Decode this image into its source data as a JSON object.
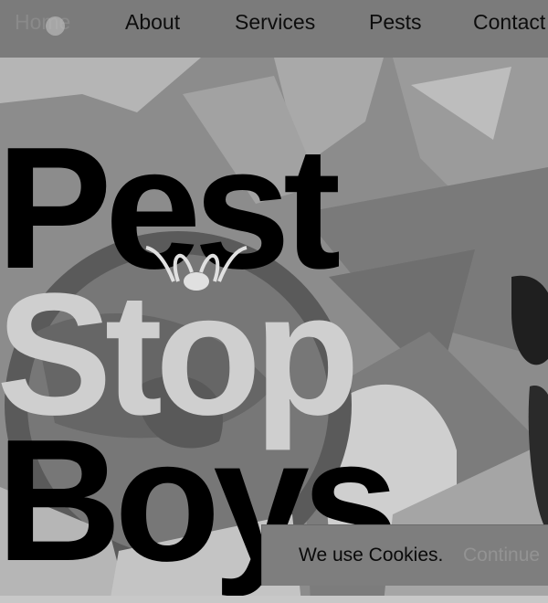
{
  "nav": {
    "items": [
      {
        "label": "Home",
        "active": true
      },
      {
        "label": "About"
      },
      {
        "label": "Services"
      },
      {
        "label": "Pests"
      },
      {
        "label": "Contact"
      }
    ]
  },
  "hero": {
    "headline": [
      "Pest",
      "Stop",
      "Boys"
    ],
    "logo_icon": "bug-icon"
  },
  "cookie_banner": {
    "text": "We use Cookies.",
    "button_label": "Continue"
  },
  "colors": {
    "nav_bg": "#7b7b7b",
    "text_dark": "#000000",
    "text_light": "#cfcfcf",
    "cookie_bg": "#7e7e7e"
  }
}
